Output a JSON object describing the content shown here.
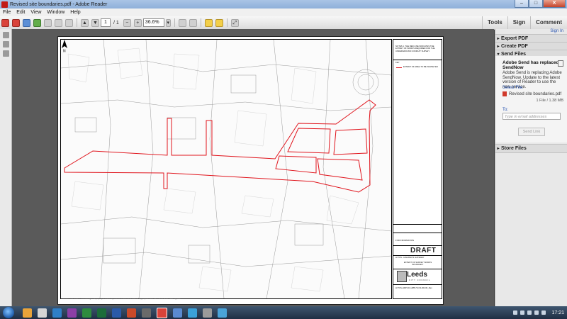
{
  "window": {
    "title": "Revised site boundaries.pdf - Adobe Reader",
    "minimize": "–",
    "maximize": "□",
    "close": "✕"
  },
  "menu": [
    "File",
    "Edit",
    "View",
    "Window",
    "Help"
  ],
  "toolbar": {
    "page_current": "1",
    "page_total": "/ 1",
    "zoom": "36.6%"
  },
  "right_tabs": [
    "Tools",
    "Sign",
    "Comment"
  ],
  "panel": {
    "sign_in": "Sign In",
    "export_pdf": "Export PDF",
    "create_pdf": "Create PDF",
    "send_files": "Send Files",
    "send_title": "Adobe Send has replaced SendNow",
    "send_message": "Adobe Send is replacing Adobe SendNow. Update to the latest version of Reader to use the new service.",
    "select_file": "Select File:",
    "file_name": "Revised site boundaries.pdf",
    "file_size": "1 File / 1.38 MB",
    "to_label": "To:",
    "email_placeholder": "Type in email addresses",
    "send_button": "Send Link",
    "store_files": "Store Files"
  },
  "drawing": {
    "notes": "NOTES 1. THE RED LINE INDICATES THE EXTENT OF WORKS REQUIRED FOR THE UNDERGROUND CONDUIT SURVEY.",
    "key_label": "KEY",
    "key_item": "EXTENT OF AREA TO BE SURVEYED",
    "purpose": "FOR INFORMATION",
    "status": "DRAFT",
    "project": "LFTCS - HIGHWAYS GATEWAY",
    "drawing_title": "EXTENT OF SURVEY WORKS BOUNDARY",
    "council": "Leeds",
    "council_sub": "CITY COUNCIL",
    "drawing_no": "LFTCS-HDP-DC-HPB-70-CS-DR-00_Rev",
    "footer": "© CROWN COPYRIGHT. This drawing is the property of Leeds City Council. It must not be used for any purpose other than that for which it was supplied."
  },
  "taskbar": {
    "time": "17:21"
  },
  "colors": {
    "boundary": "#e0141c",
    "accent": "#2a55b1"
  }
}
